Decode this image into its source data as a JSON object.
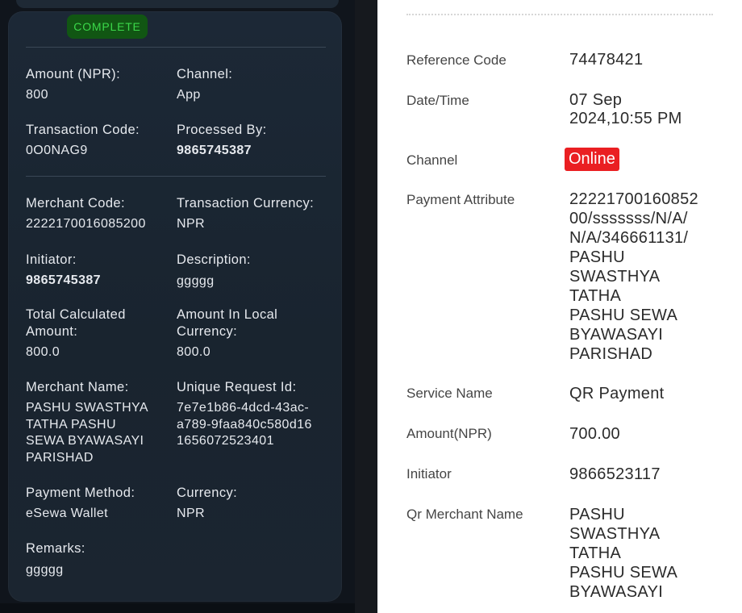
{
  "left_panel": {
    "status": "COMPLETE",
    "fields": {
      "amount": {
        "label": "Amount (NPR):",
        "value": "800"
      },
      "channel": {
        "label": "Channel:",
        "value": "App"
      },
      "transaction_code": {
        "label": "Transaction Code:",
        "value": "0O0NAG9"
      },
      "processed_by": {
        "label": "Processed By:",
        "value": "9865745387"
      },
      "merchant_code": {
        "label": "Merchant Code:",
        "value": "2222170016085200"
      },
      "transaction_currency": {
        "label": "Transaction Currency:",
        "value": "NPR"
      },
      "initiator": {
        "label": "Initiator:",
        "value": "9865745387"
      },
      "description": {
        "label": "Description:",
        "value": "ggggg"
      },
      "total_calculated_amount": {
        "label_line1": "Total Calculated",
        "label_line2": "Amount:",
        "value": "800.0"
      },
      "amount_local_currency": {
        "label_line1": "Amount In Local",
        "label_line2": "Currency:",
        "value": "800.0"
      },
      "merchant_name": {
        "label": "Merchant Name:",
        "value_lines": [
          "PASHU SWASTHYA",
          "TATHA PASHU",
          "SEWA BYAWASAYI",
          "PARISHAD"
        ]
      },
      "unique_request_id": {
        "label": "Unique Request Id:",
        "value_lines": [
          "7e7e1b86-4dcd-43ac-",
          "a789-9faa840c580d16",
          "1656072523401"
        ]
      },
      "payment_method": {
        "label": "Payment Method:",
        "value": "eSewa Wallet"
      },
      "currency": {
        "label": "Currency:",
        "value": "NPR"
      },
      "remarks": {
        "label": "Remarks:",
        "value": "ggggg"
      }
    }
  },
  "right_panel": {
    "reference_code": {
      "label": "Reference Code",
      "value": "74478421"
    },
    "date_time": {
      "label": "Date/Time",
      "value_lines": [
        "07 Sep",
        "2024,10:55 PM"
      ]
    },
    "channel": {
      "label": "Channel",
      "value": "Online"
    },
    "payment_attribute": {
      "label": "Payment Attribute",
      "value_lines": [
        "22221700160852",
        "00/sssssss/N/A/",
        "N/A/346661131/",
        "PASHU",
        "SWASTHYA",
        "TATHA",
        "PASHU SEWA",
        "BYAWASAYI",
        "PARISHAD"
      ]
    },
    "service_name": {
      "label": "Service Name",
      "value": "QR Payment"
    },
    "amount": {
      "label": "Amount(NPR)",
      "value": "700.00"
    },
    "initiator": {
      "label": "Initiator",
      "value": "9866523117"
    },
    "qr_merchant_name": {
      "label": "Qr Merchant Name",
      "value_lines": [
        "PASHU",
        "SWASTHYA",
        "TATHA",
        "PASHU SEWA",
        "BYAWASAYI"
      ]
    }
  },
  "colors": {
    "status_bg": "#115613",
    "status_text": "#3bd84a",
    "online_badge": "#ea1f22",
    "dark_card": "#1c2836"
  }
}
